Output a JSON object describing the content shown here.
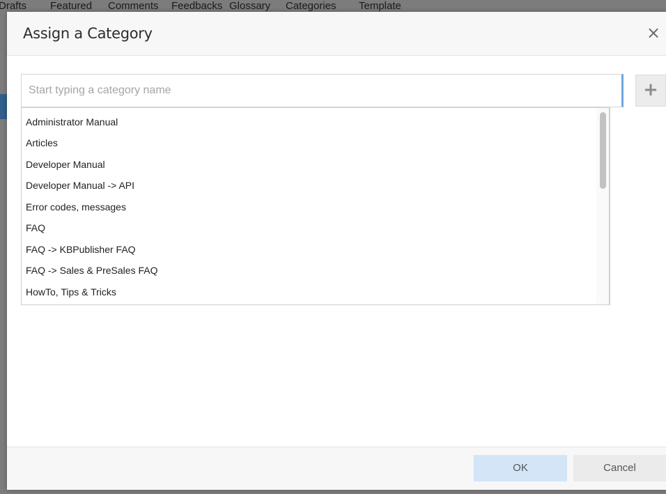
{
  "background": {
    "tabs": [
      "Drafts",
      "Featured",
      "Comments",
      "Feedbacks",
      "Glossary",
      "Categories",
      "Template"
    ]
  },
  "modal": {
    "title": "Assign a Category",
    "close_label": "×",
    "search": {
      "placeholder": "Start typing a category name",
      "value": ""
    },
    "add_label": "+",
    "categories": [
      "Administrator Manual",
      "Articles",
      "Developer Manual",
      "Developer Manual -> API",
      "Error codes, messages",
      "FAQ",
      "FAQ -> KBPublisher FAQ",
      "FAQ -> Sales & PreSales FAQ",
      "HowTo, Tips & Tricks"
    ],
    "footer": {
      "ok_label": "OK",
      "cancel_label": "Cancel"
    }
  }
}
